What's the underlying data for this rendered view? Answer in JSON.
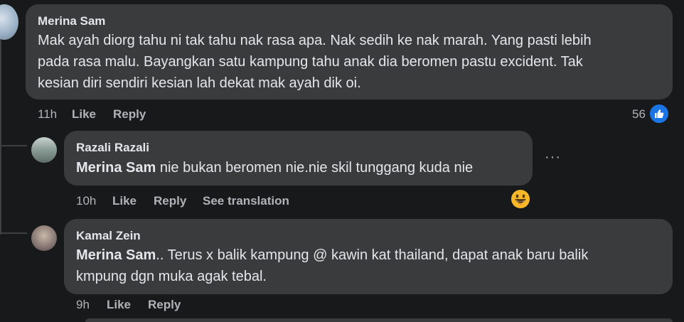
{
  "comments": [
    {
      "author": "Merina Sam",
      "text_lines": [
        "Mak ayah diorg tahu ni tak tahu nak rasa apa. Nak sedih ke nak marah. Yang pasti lebih",
        "pada rasa malu. Bayangkan satu kampung tahu anak dia beromen pastu excident. Tak",
        "kesian diri sendiri kesian lah dekat mak ayah dik oi."
      ],
      "time": "11h",
      "like_label": "Like",
      "reply_label": "Reply",
      "reaction_count": "56",
      "reaction_icon": "thumbs-up-icon",
      "avatar_color": "#9db3c8"
    },
    {
      "author": "Razali Razali",
      "mention": "Merina Sam",
      "text": " nie bukan beromen nie.nie skil tunggang kuda nie",
      "time": "10h",
      "like_label": "Like",
      "reply_label": "Reply",
      "translate_label": "See translation",
      "more_label": "···",
      "reaction_icon": "grinning-emoji-icon",
      "avatar_color": "#7a8a86"
    },
    {
      "author": "Kamal Zein",
      "mention": "Merina Sam",
      "text_first": ".. Terus x balik kampung @ kawin kat thailand, dapat anak baru balik",
      "text_second": "kmpung dgn muka agak tebal.",
      "time": "9h",
      "like_label": "Like",
      "reply_label": "Reply",
      "avatar_color": "#8a7a76"
    }
  ],
  "colors": {
    "background": "#18191a",
    "bubble": "#3a3b3c",
    "like_blue": "#1b74e4"
  }
}
